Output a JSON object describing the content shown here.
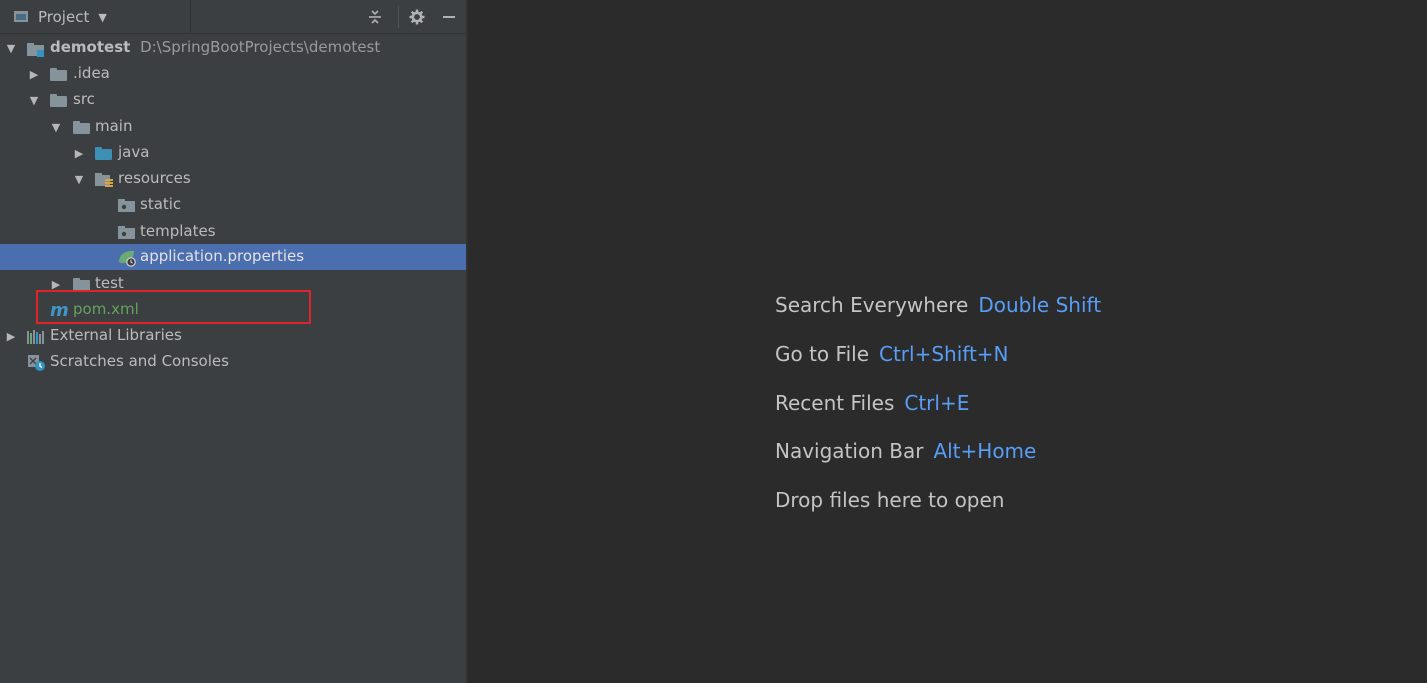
{
  "panel": {
    "title": "Project",
    "icons": {
      "collapse": "collapse-all-icon",
      "settings": "gear-icon",
      "hide": "minimize-icon"
    }
  },
  "tree": {
    "root": {
      "name": "demotest",
      "path": "D:\\SpringBootProjects\\demotest"
    },
    "idea": ".idea",
    "src": "src",
    "main": "main",
    "java": "java",
    "resources": "resources",
    "static": "static",
    "templates": "templates",
    "application_properties": "application.properties",
    "test": "test",
    "pom": "pom.xml",
    "external_libraries": "External Libraries",
    "scratches": "Scratches and Consoles"
  },
  "editor_hints": [
    {
      "label": "Search Everywhere",
      "shortcut": "Double Shift"
    },
    {
      "label": "Go to File",
      "shortcut": "Ctrl+Shift+N"
    },
    {
      "label": "Recent Files",
      "shortcut": "Ctrl+E"
    },
    {
      "label": "Navigation Bar",
      "shortcut": "Alt+Home"
    },
    {
      "label": "Drop files here to open",
      "shortcut": ""
    }
  ],
  "colors": {
    "panel_bg": "#3c3f41",
    "editor_bg": "#2b2b2b",
    "selection": "#4b6eaf",
    "shortcut": "#589df6",
    "highlight_box": "#e0242a"
  }
}
